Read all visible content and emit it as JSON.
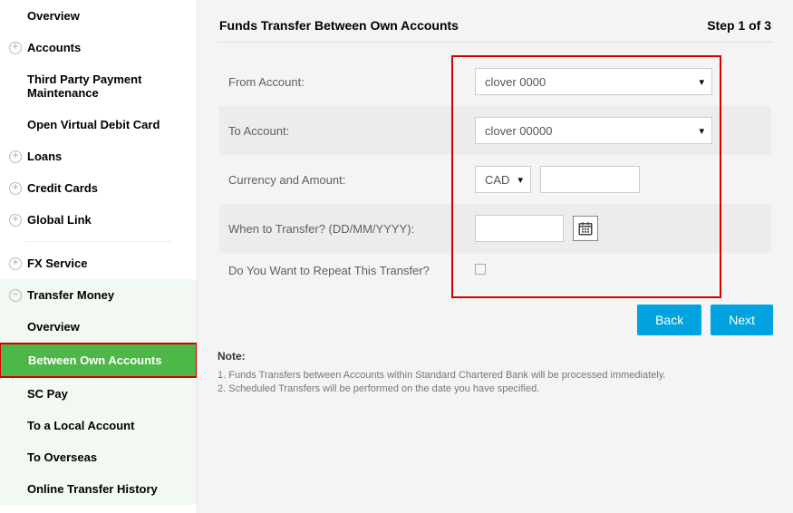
{
  "sidebar": {
    "items": [
      {
        "label": "Overview",
        "icon": null
      },
      {
        "label": "Accounts",
        "icon": "plus"
      },
      {
        "label": "Third Party Payment Maintenance",
        "icon": null
      },
      {
        "label": "Open Virtual Debit Card",
        "icon": null
      },
      {
        "label": "Loans",
        "icon": "plus"
      },
      {
        "label": "Credit Cards",
        "icon": "plus"
      },
      {
        "label": "Global Link",
        "icon": "plus"
      },
      {
        "label": "FX Service",
        "icon": "plus"
      }
    ],
    "transfer": {
      "header": "Transfer Money",
      "icon": "minus",
      "items": [
        {
          "label": "Overview"
        },
        {
          "label": "Between Own Accounts",
          "active": true
        },
        {
          "label": "SC Pay"
        },
        {
          "label": "To a Local Account"
        },
        {
          "label": "To Overseas"
        },
        {
          "label": "Online Transfer History"
        }
      ]
    }
  },
  "header": {
    "title": "Funds Transfer Between Own Accounts",
    "step": "Step 1 of 3"
  },
  "form": {
    "from_label": "From Account:",
    "from_value": "clover 0000",
    "to_label": "To Account:",
    "to_value": "clover 00000",
    "currency_label": "Currency and Amount:",
    "currency_value": "CAD",
    "amount_value": "",
    "when_label": "When to Transfer? (DD/MM/YYYY):",
    "when_value": "",
    "repeat_label": "Do You Want to Repeat This Transfer?"
  },
  "buttons": {
    "back": "Back",
    "next": "Next"
  },
  "notes": {
    "title": "Note:",
    "items": [
      "1. Funds Transfers between Accounts within Standard Chartered Bank will be processed immediately.",
      "2. Scheduled Transfers will be performed on the date you have specified."
    ]
  }
}
